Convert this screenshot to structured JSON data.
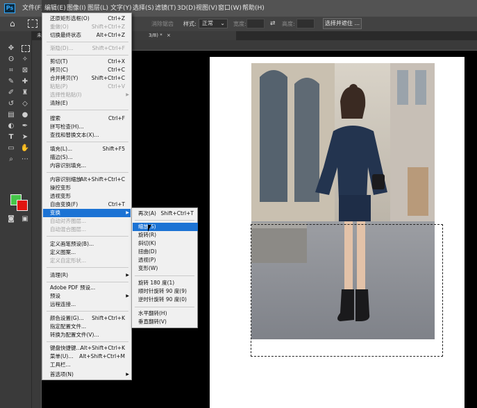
{
  "menubar": {
    "logo": "Ps",
    "items": [
      "文件(F)",
      "编辑(E)",
      "图像(I)",
      "图层(L)",
      "文字(Y)",
      "选择(S)",
      "滤镜(T)",
      "3D(D)",
      "视图(V)",
      "窗口(W)",
      "帮助(H)"
    ],
    "active_index": 1
  },
  "options": {
    "antialias_label": "消除锯齿",
    "style_label": "样式:",
    "style_value": "正常",
    "width_label": "宽度:",
    "height_label": "高度:",
    "select_mask_button": "选择并遮住 ..."
  },
  "tabs": {
    "doc_tab_partial": "未",
    "doc_tab_right": "3/8) *",
    "close_glyph": "×"
  },
  "colors": {
    "foreground": "#46c64a",
    "background": "#e0140f",
    "menu_highlight": "#1c73d4"
  },
  "edit_menu": {
    "items": [
      {
        "label": "还原矩形选框(O)",
        "shortcut": "Ctrl+Z"
      },
      {
        "label": "重做(O)",
        "shortcut": "Shift+Ctrl+Z",
        "disabled": true
      },
      {
        "label": "切换最终状态",
        "shortcut": "Alt+Ctrl+Z"
      },
      {
        "sep": true
      },
      {
        "label": "渐隐(D)...",
        "shortcut": "Shift+Ctrl+F",
        "disabled": true
      },
      {
        "sep": true
      },
      {
        "label": "剪切(T)",
        "shortcut": "Ctrl+X"
      },
      {
        "label": "拷贝(C)",
        "shortcut": "Ctrl+C"
      },
      {
        "label": "合并拷贝(Y)",
        "shortcut": "Shift+Ctrl+C"
      },
      {
        "label": "粘贴(P)",
        "shortcut": "Ctrl+V",
        "disabled": true
      },
      {
        "label": "选择性粘贴(I)",
        "submenu": true,
        "disabled": true
      },
      {
        "label": "清除(E)"
      },
      {
        "sep": true
      },
      {
        "label": "搜索",
        "shortcut": "Ctrl+F"
      },
      {
        "label": "拼写检查(H)..."
      },
      {
        "label": "查找和替换文本(X)..."
      },
      {
        "sep": true
      },
      {
        "label": "填充(L)...",
        "shortcut": "Shift+F5"
      },
      {
        "label": "描边(S)..."
      },
      {
        "label": "内容识别填充..."
      },
      {
        "sep": true
      },
      {
        "label": "内容识别缩放",
        "shortcut": "Alt+Shift+Ctrl+C"
      },
      {
        "label": "操控变形"
      },
      {
        "label": "透视变形"
      },
      {
        "label": "自由变换(F)",
        "shortcut": "Ctrl+T"
      },
      {
        "label": "变换",
        "submenu": true,
        "highlight": true
      },
      {
        "label": "自动对齐图层...",
        "disabled": true
      },
      {
        "label": "自动混合图层...",
        "disabled": true
      },
      {
        "sep": true
      },
      {
        "label": "定义画笔预设(B)..."
      },
      {
        "label": "定义图案..."
      },
      {
        "label": "定义自定形状...",
        "disabled": true
      },
      {
        "sep": true
      },
      {
        "label": "清理(R)",
        "submenu": true
      },
      {
        "sep": true
      },
      {
        "label": "Adobe PDF 预设..."
      },
      {
        "label": "预设",
        "submenu": true
      },
      {
        "label": "远程连接..."
      },
      {
        "sep": true
      },
      {
        "label": "颜色设置(G)...",
        "shortcut": "Shift+Ctrl+K"
      },
      {
        "label": "指定配置文件..."
      },
      {
        "label": "转换为配置文件(V)..."
      },
      {
        "sep": true
      },
      {
        "label": "键盘快捷键...",
        "shortcut": "Alt+Shift+Ctrl+K"
      },
      {
        "label": "菜单(U)...",
        "shortcut": "Alt+Shift+Ctrl+M"
      },
      {
        "label": "工具栏..."
      },
      {
        "label": "首选项(N)",
        "submenu": true
      }
    ]
  },
  "transform_submenu": {
    "items": [
      {
        "label": "再次(A)",
        "shortcut": "Shift+Ctrl+T"
      },
      {
        "sep": true
      },
      {
        "label": "缩放(S)",
        "highlight": true
      },
      {
        "label": "旋转(R)"
      },
      {
        "label": "斜切(K)"
      },
      {
        "label": "扭曲(D)"
      },
      {
        "label": "透视(P)"
      },
      {
        "label": "变形(W)"
      },
      {
        "sep": true
      },
      {
        "label": "旋转 180 度(1)"
      },
      {
        "label": "顺时针旋转 90 度(9)"
      },
      {
        "label": "逆时针旋转 90 度(0)"
      },
      {
        "sep": true
      },
      {
        "label": "水平翻转(H)"
      },
      {
        "label": "垂直翻转(V)"
      }
    ]
  }
}
